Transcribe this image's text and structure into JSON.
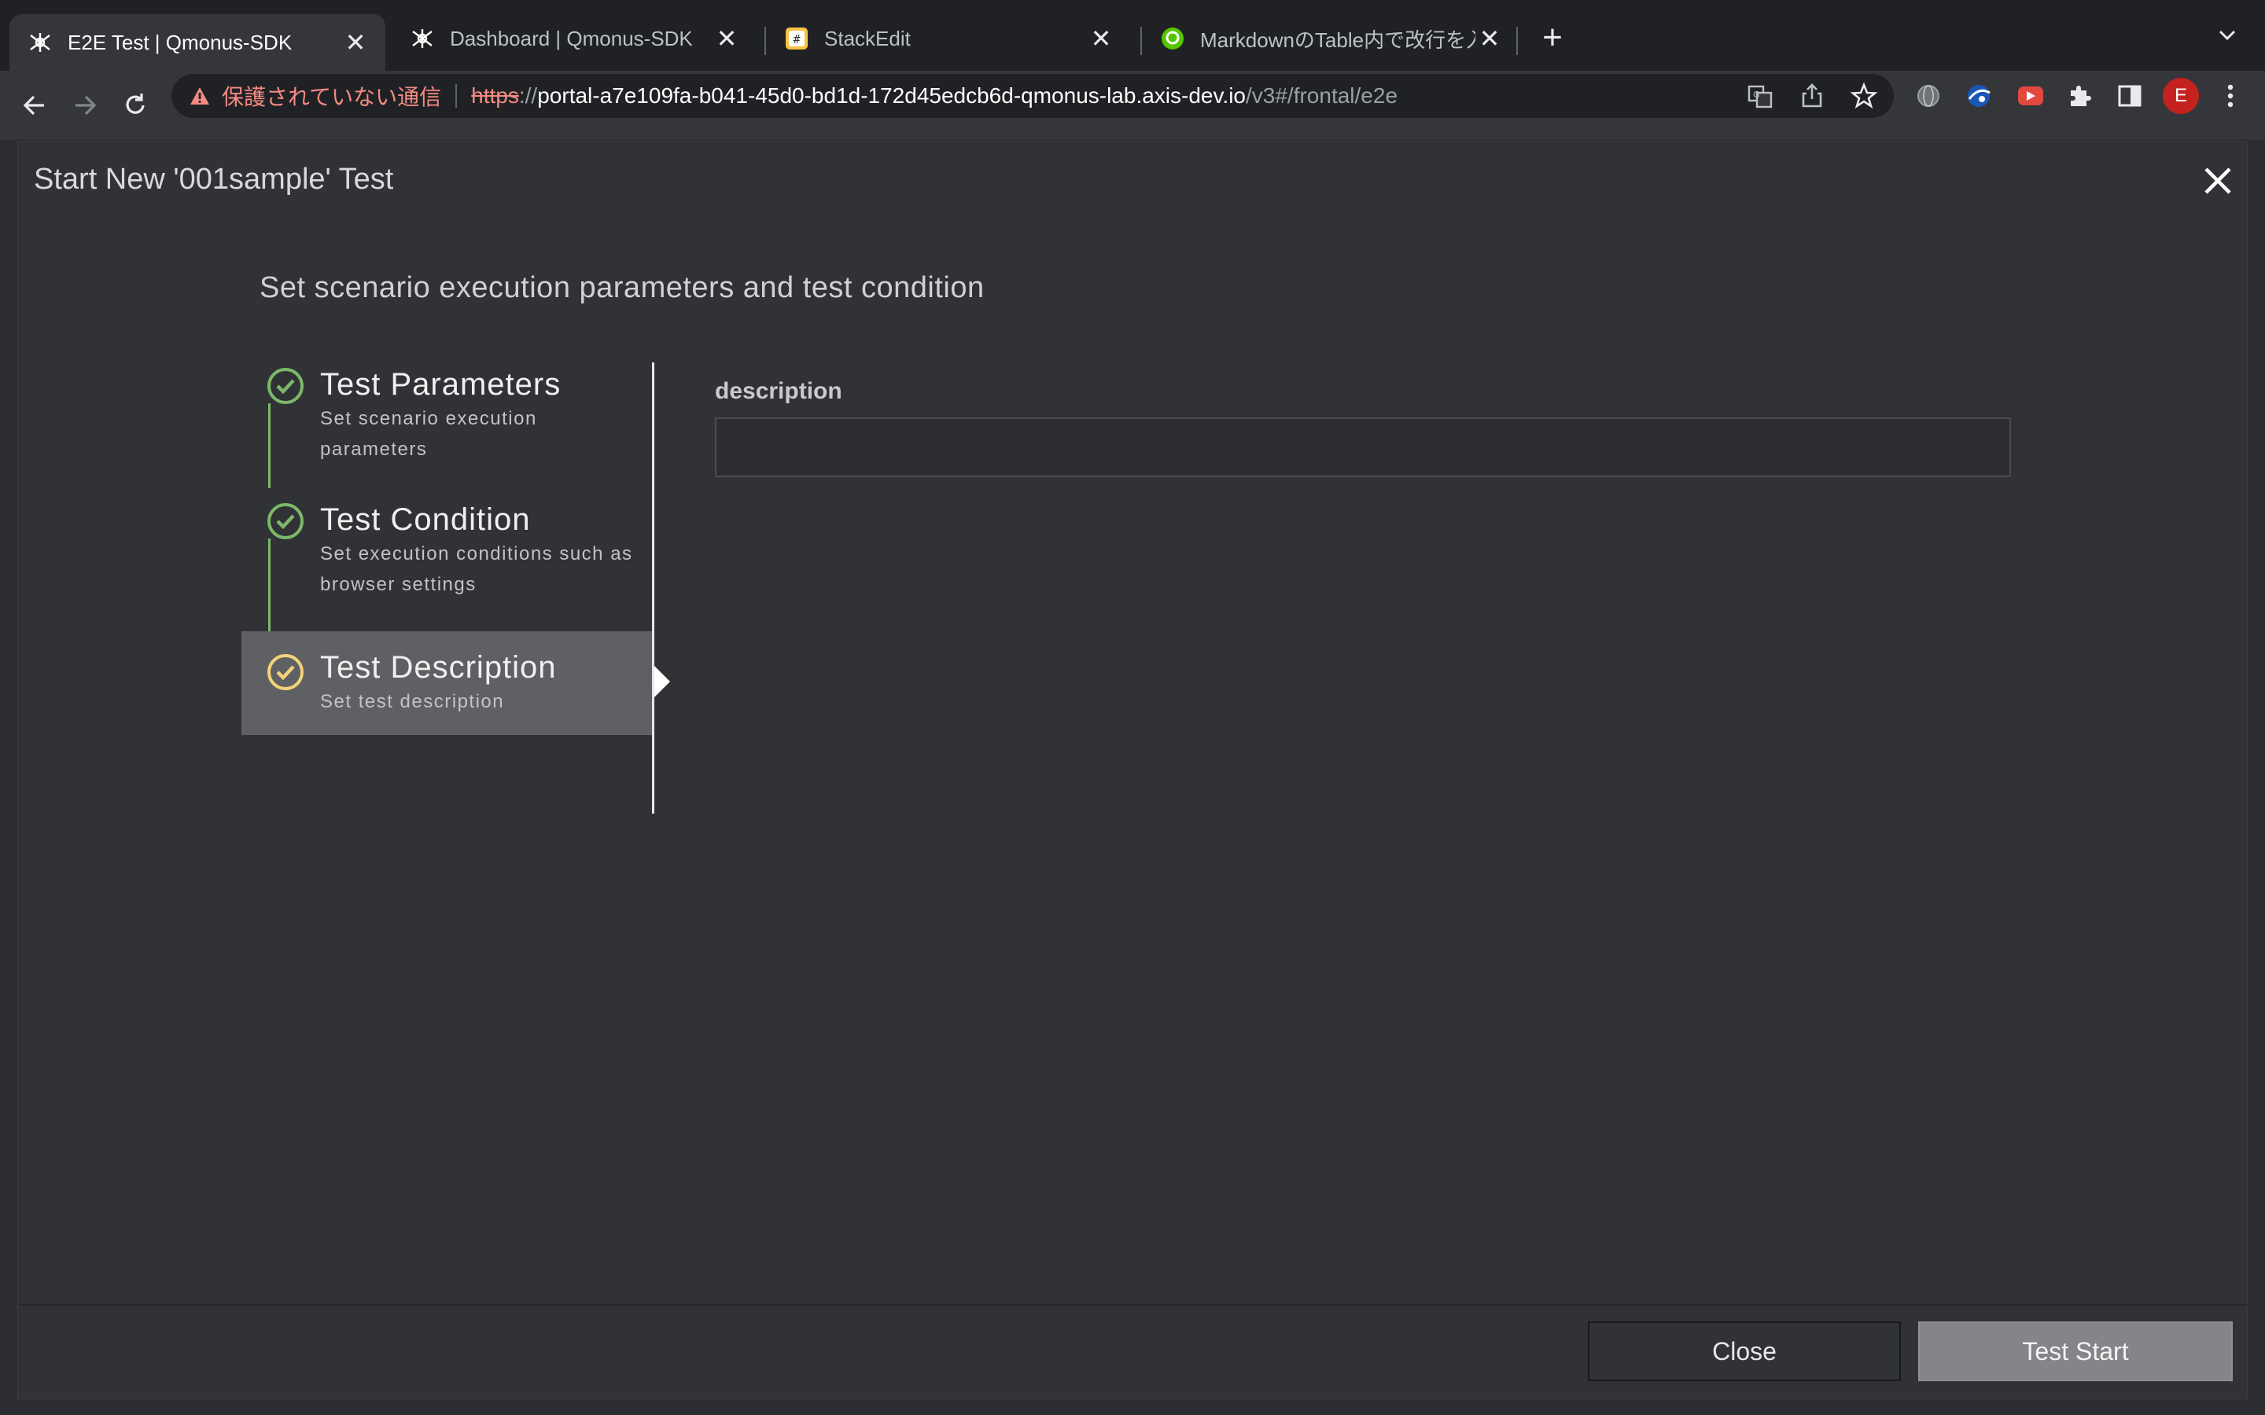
{
  "browser": {
    "tabs": [
      {
        "title": "E2E Test | Qmonus-SDK",
        "active": true
      },
      {
        "title": "Dashboard | Qmonus-SDK",
        "active": false
      },
      {
        "title": "StackEdit",
        "active": false
      },
      {
        "title": "MarkdownのTable内で改行を入れ",
        "active": false
      }
    ],
    "new_tab_label": "+",
    "tab_menu_label": "⌄",
    "close_glyph": "✕",
    "address": {
      "security_warning": "保護されていない通信",
      "scheme": "https",
      "scheme_sep": "://",
      "host": "portal-a7e109fa-b041-45d0-bd1d-172d45edcb6d-qmonus-lab.axis-dev.io",
      "path": "/v3#/frontal/e2e"
    },
    "profile_initial": "E"
  },
  "modal": {
    "title": "Start New '001sample' Test",
    "subtitle": "Set scenario execution parameters and test condition",
    "steps": [
      {
        "title": "Test Parameters",
        "description": "Set scenario execution parameters",
        "status": "completed"
      },
      {
        "title": "Test Condition",
        "description": "Set execution conditions such as browser settings",
        "status": "completed"
      },
      {
        "title": "Test Description",
        "description": "Set test description",
        "status": "current"
      }
    ],
    "field": {
      "label": "description",
      "value": "",
      "placeholder": ""
    },
    "buttons": {
      "close": "Close",
      "start": "Test Start"
    }
  },
  "colors": {
    "completed_check": "#7cb86a",
    "current_check": "#f3d27a",
    "active_step_bg": "#5e6064",
    "modal_bg": "#303236",
    "warning": "#f28b82"
  },
  "icons": [
    "back-arrow-icon",
    "forward-arrow-icon",
    "reload-icon",
    "warning-icon",
    "translate-icon",
    "share-icon",
    "star-icon",
    "extensions-icon",
    "sidepanel-icon",
    "more-icon",
    "close-icon",
    "check-circle-icon"
  ]
}
